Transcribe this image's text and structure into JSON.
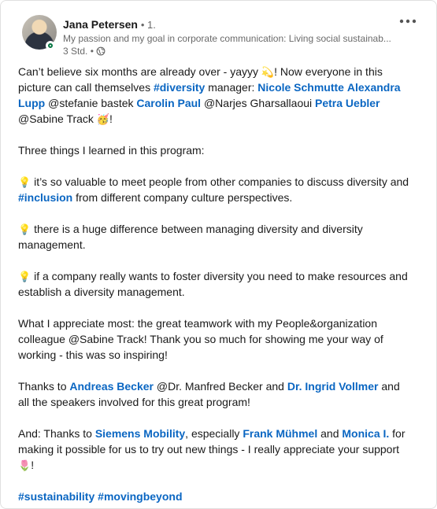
{
  "author": {
    "name": "Jana Petersen",
    "degree": "• 1.",
    "headline": "My passion and my goal in corporate communication: Living social sustainab...",
    "time": "3 Std. •"
  },
  "icons": {
    "more": "more-horizontal-icon",
    "visibility": "globe-icon",
    "badge": "online-status-icon"
  },
  "colors": {
    "link": "#0a66c2",
    "online": "#057642"
  },
  "post": {
    "p1": {
      "t1": "Can’t believe six months are already over - yayyy ",
      "e1": "💫",
      "t2": "! Now everyone in this picture can call themselves ",
      "tag_diversity": "#diversity",
      "t3": " manager: ",
      "m_nicole": "Nicole Schmutte",
      "m_alexandra": "Alexandra Lupp",
      "t4": " @stefanie bastek ",
      "m_carolin": "Carolin Paul",
      "t5": " @Narjes Gharsallaoui ",
      "m_petra": "Petra Uebler",
      "t6": " @Sabine Track",
      "e2": "🥳",
      "t7": "!"
    },
    "p2": "Three things I learned in this program:",
    "p3": {
      "e": "💡",
      "t1": " it’s so valuable to meet people from other companies to discuss diversity and ",
      "tag_inclusion": "#inclusion",
      "t2": " from different company culture perspectives."
    },
    "p4": {
      "e": "💡",
      "t1": "  there is a huge difference between managing diversity and diversity management."
    },
    "p5": {
      "e": "💡",
      "t1": " if a company really wants to foster diversity you need to make resources and establish a diversity management."
    },
    "p6": "What I appreciate most: the great teamwork with my People&organization colleague @Sabine Track! Thank you so much for showing me your way of working - this was so inspiring!",
    "p7": {
      "t1": "Thanks to ",
      "m_andreas": "Andreas Becker",
      "t2": " @Dr. Manfred Becker and ",
      "m_ingrid": "Dr. Ingrid Vollmer",
      "t3": " and all the speakers involved for this great program!"
    },
    "p8": {
      "t1": "And: Thanks to ",
      "m_siemens": "Siemens Mobility",
      "t2": ", especially ",
      "m_frank": "Frank Mühmel",
      "t3": " and ",
      "m_monica": "Monica I.",
      "t4": " for making it possible for us to try out new things - I really appreciate your support ",
      "e": "🌷",
      "t5": "!"
    },
    "hashtags": {
      "h1": "#sustainability",
      "h2": "#movingbeyond"
    }
  }
}
